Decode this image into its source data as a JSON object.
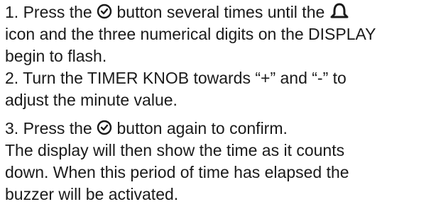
{
  "instructions": {
    "step1": {
      "part_a": "1. Press the ",
      "part_b": " button several times until the ",
      "part_c": "icon and the three numerical digits on the DISPLAY",
      "part_d": "begin to flash.",
      "icons": [
        "clock-icon",
        "bell-icon"
      ]
    },
    "step2": {
      "line1": "2. Turn the TIMER KNOB towards “+” and “-” to",
      "line2": "adjust the minute value."
    },
    "step3": {
      "part_a": "3. Press the ",
      "part_b": " button again to confirm.",
      "icons": [
        "clock-icon"
      ]
    },
    "note": {
      "line1": "The display will then show the time as it counts",
      "line2": "down. When this period of time has elapsed the",
      "line3": "buzzer will be activated."
    }
  }
}
